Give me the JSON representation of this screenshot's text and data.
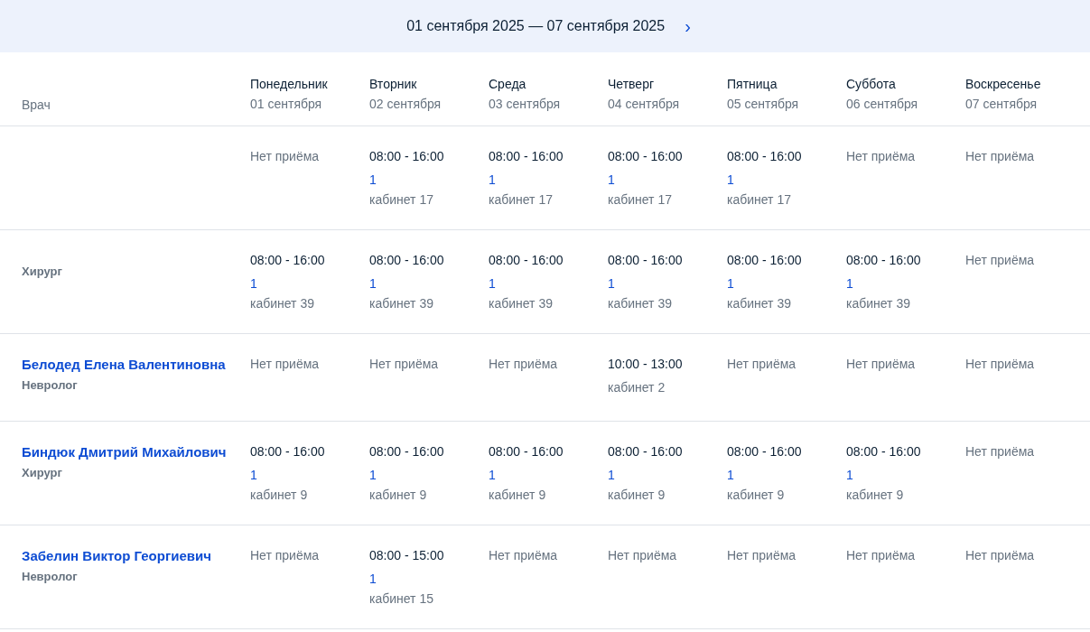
{
  "week_nav": {
    "range": "01 сентября 2025 — 07 сентября 2025",
    "next": "›"
  },
  "table": {
    "doctor_header": "Врач",
    "days": [
      {
        "weekday": "Понедельник",
        "date": "01 сентября"
      },
      {
        "weekday": "Вторник",
        "date": "02 сентября"
      },
      {
        "weekday": "Среда",
        "date": "03 сентября"
      },
      {
        "weekday": "Четверг",
        "date": "04 сентября"
      },
      {
        "weekday": "Пятница",
        "date": "05 сентября"
      },
      {
        "weekday": "Суббота",
        "date": "06 сентября"
      },
      {
        "weekday": "Воскресенье",
        "date": "07 сентября"
      }
    ],
    "rows": [
      {
        "cells": [
          {
            "kind": "none",
            "text": "Нет приёма"
          },
          {
            "kind": "shift",
            "time": "08:00 - 16:00",
            "slots": "1",
            "room": "кабинет 17"
          },
          {
            "kind": "shift",
            "time": "08:00 - 16:00",
            "slots": "1",
            "room": "кабинет 17"
          },
          {
            "kind": "shift",
            "time": "08:00 - 16:00",
            "slots": "1",
            "room": "кабинет 17"
          },
          {
            "kind": "shift",
            "time": "08:00 - 16:00",
            "slots": "1",
            "room": "кабинет 17"
          },
          {
            "kind": "none",
            "text": "Нет приёма"
          },
          {
            "kind": "none",
            "text": "Нет приёма"
          }
        ]
      },
      {
        "specialty": "Хирург",
        "cells": [
          {
            "kind": "shift",
            "time": "08:00 - 16:00",
            "slots": "1",
            "room": "кабинет 39"
          },
          {
            "kind": "shift",
            "time": "08:00 - 16:00",
            "slots": "1",
            "room": "кабинет 39"
          },
          {
            "kind": "shift",
            "time": "08:00 - 16:00",
            "slots": "1",
            "room": "кабинет 39"
          },
          {
            "kind": "shift",
            "time": "08:00 - 16:00",
            "slots": "1",
            "room": "кабинет 39"
          },
          {
            "kind": "shift",
            "time": "08:00 - 16:00",
            "slots": "1",
            "room": "кабинет 39"
          },
          {
            "kind": "shift",
            "time": "08:00 - 16:00",
            "slots": "1",
            "room": "кабинет 39"
          },
          {
            "kind": "none",
            "text": "Нет приёма"
          }
        ]
      },
      {
        "name": "Белодед Елена Валентиновна",
        "specialty": "Невролог",
        "cells": [
          {
            "kind": "none",
            "text": "Нет приёма"
          },
          {
            "kind": "none",
            "text": "Нет приёма"
          },
          {
            "kind": "none",
            "text": "Нет приёма"
          },
          {
            "kind": "shift",
            "time": "10:00 - 13:00",
            "room": "кабинет 2"
          },
          {
            "kind": "none",
            "text": "Нет приёма"
          },
          {
            "kind": "none",
            "text": "Нет приёма"
          },
          {
            "kind": "none",
            "text": "Нет приёма"
          }
        ]
      },
      {
        "name": "Биндюк Дмитрий Михайлович",
        "specialty": "Хирург",
        "cells": [
          {
            "kind": "shift",
            "time": "08:00 - 16:00",
            "slots": "1",
            "room": "кабинет 9"
          },
          {
            "kind": "shift",
            "time": "08:00 - 16:00",
            "slots": "1",
            "room": "кабинет 9"
          },
          {
            "kind": "shift",
            "time": "08:00 - 16:00",
            "slots": "1",
            "room": "кабинет 9"
          },
          {
            "kind": "shift",
            "time": "08:00 - 16:00",
            "slots": "1",
            "room": "кабинет 9"
          },
          {
            "kind": "shift",
            "time": "08:00 - 16:00",
            "slots": "1",
            "room": "кабинет 9"
          },
          {
            "kind": "shift",
            "time": "08:00 - 16:00",
            "slots": "1",
            "room": "кабинет 9"
          },
          {
            "kind": "none",
            "text": "Нет приёма"
          }
        ]
      },
      {
        "name": "Забелин Виктор Георгиевич",
        "specialty": "Невролог",
        "cells": [
          {
            "kind": "none",
            "text": "Нет приёма"
          },
          {
            "kind": "shift",
            "time": "08:00 - 15:00",
            "slots": "1",
            "room": "кабинет 15"
          },
          {
            "kind": "none",
            "text": "Нет приёма"
          },
          {
            "kind": "none",
            "text": "Нет приёма"
          },
          {
            "kind": "none",
            "text": "Нет приёма"
          },
          {
            "kind": "none",
            "text": "Нет приёма"
          },
          {
            "kind": "none",
            "text": "Нет приёма"
          }
        ]
      }
    ]
  }
}
